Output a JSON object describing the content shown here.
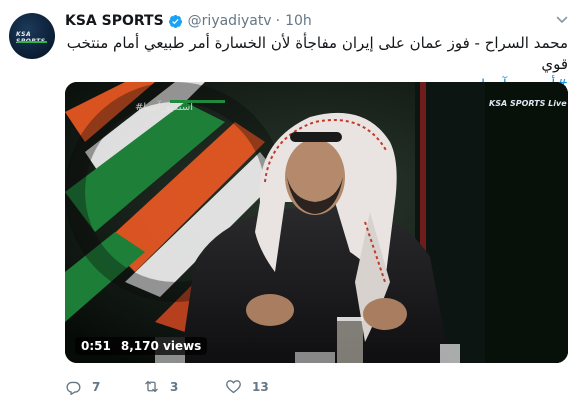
{
  "tweet": {
    "author_name": "KSA SPORTS",
    "handle": "@riyadiyatv",
    "separator": "·",
    "time": "10h",
    "text_line1": "محمد السراح - فوز عمان على إيران مفاجأة لأن الخسارة أمر طبيعي أمام منتخب قوي",
    "hashtag": "#أستديو_آسيا",
    "avatar_logo_text": "KSA SPORTS"
  },
  "video": {
    "duration": "0:51",
    "views": "8,170 views",
    "screen_text_left": "#استديو_آسيا",
    "channel_bug": "KSA SPORTS Live"
  },
  "actions": {
    "replies": "7",
    "retweets": "3",
    "likes": "13"
  },
  "colors": {
    "link": "#1b95e0",
    "muted": "#657786",
    "verified": "#1da1f2"
  }
}
